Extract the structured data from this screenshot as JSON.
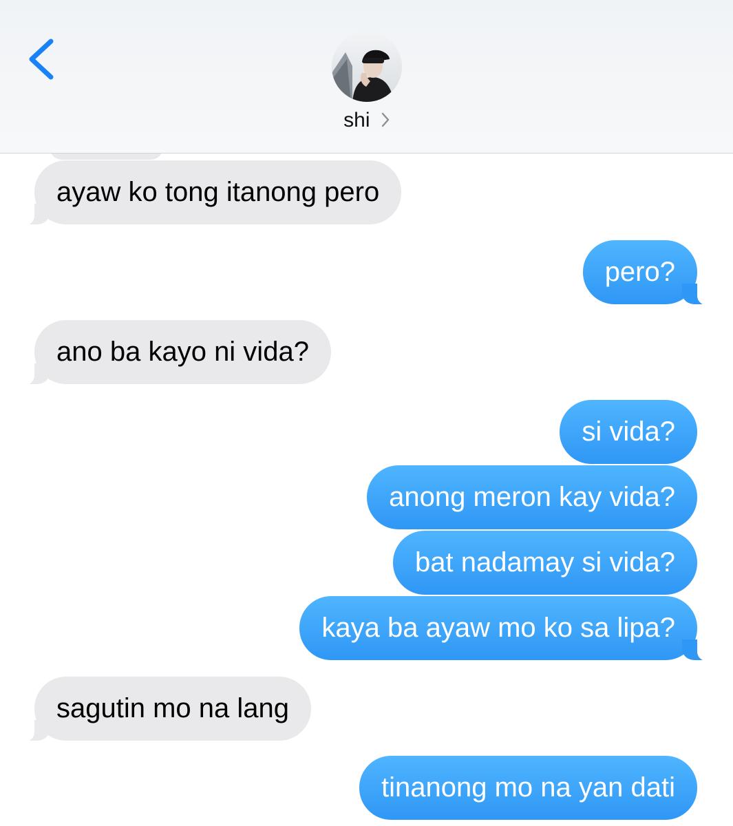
{
  "header": {
    "back_icon": "chevron-left-icon",
    "contact_name": "shi",
    "contact_chevron_icon": "chevron-right-icon",
    "accent_color": "#1a82f7"
  },
  "messages": [
    {
      "direction": "received",
      "text": "ayaw ko tong itanong pero"
    },
    {
      "direction": "sent",
      "text": "pero?"
    },
    {
      "direction": "received",
      "text": "ano ba kayo ni vida?"
    },
    {
      "direction": "sent",
      "text": "si vida?"
    },
    {
      "direction": "sent",
      "text": "anong meron kay vida?"
    },
    {
      "direction": "sent",
      "text": "bat nadamay si vida?"
    },
    {
      "direction": "sent",
      "text": "kaya ba ayaw mo ko sa lipa?"
    },
    {
      "direction": "received",
      "text": "sagutin mo na lang"
    },
    {
      "direction": "sent",
      "text": "tinanong mo na yan dati"
    }
  ],
  "colors": {
    "received_bubble": "#e9e9eb",
    "sent_bubble": "#2f97f5",
    "sent_text": "#ffffff",
    "received_text": "#000000"
  }
}
